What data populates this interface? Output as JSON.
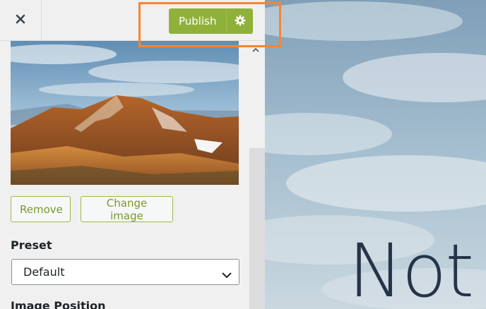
{
  "header": {
    "publish_label": "Publish",
    "close_icon": "close-icon",
    "settings_icon": "gear-icon"
  },
  "image_controls": {
    "remove_label": "Remove",
    "change_label": "Change image"
  },
  "preset": {
    "label": "Preset",
    "selected": "Default"
  },
  "image_position": {
    "label": "Image Position"
  },
  "preview": {
    "title_fragment": "Not"
  },
  "colors": {
    "accent": "#8fb13a",
    "highlight": "#f7852f",
    "panel_bg": "#f0f0f1"
  }
}
